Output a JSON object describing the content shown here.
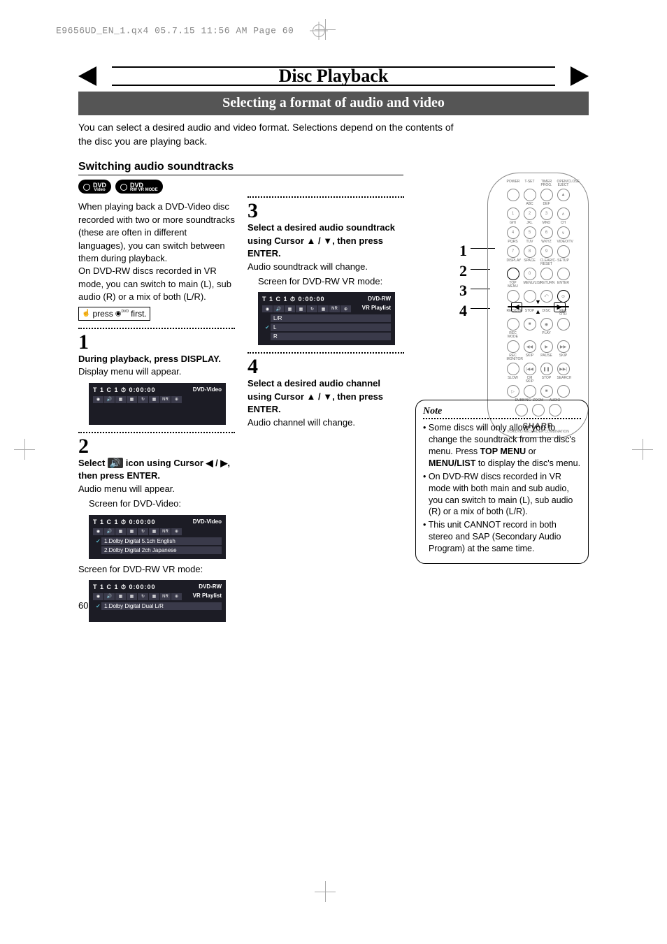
{
  "header_tag": "E9656UD_EN_1.qx4  05.7.15  11:56 AM  Page 60",
  "chapter_title": "Disc Playback",
  "section_title": "Selecting a format of audio and video",
  "intro": "You can select a desired audio and video format. Selections depend on the contents of the disc you are playing back.",
  "subhead": "Switching audio soundtracks",
  "badges": {
    "a": "DVD",
    "a_sub": "Video",
    "b": "DVD",
    "b_sub": "RW VR MODE"
  },
  "col1": {
    "p1": "When playing back a DVD-Video disc recorded with two or more soundtracks (these are often in different languages), you can switch between them during playback.",
    "p2": "On DVD-RW discs recorded in VR mode, you can switch to main (L), sub audio (R) or a mix of both (L/R).",
    "pressbox_pre": "press",
    "pressbox_post": "first.",
    "step1_instr": "During playback, press DISPLAY.",
    "step1_body": "Display menu will appear.",
    "step2_instr_a": "Select ",
    "step2_instr_b": " icon using Cursor ◀ / ▶, then press ENTER.",
    "step2_body": "Audio menu will appear.",
    "caption_dvdvideo": "Screen for DVD-Video:",
    "caption_dvdrwvr": "Screen for DVD-RW VR mode:"
  },
  "col2": {
    "step3_instr": "Select a desired audio soundtrack using Cursor ▲ / ▼, then press ENTER.",
    "step3_body": "Audio soundtrack will change.",
    "caption_dvdrwvr": "Screen for DVD-RW VR mode:",
    "step4_instr": "Select a desired audio channel using Cursor ▲ / ▼, then press ENTER.",
    "step4_body": "Audio channel will change."
  },
  "osd": {
    "title_line": "T  1  C  1  ⏱ 0:00:00",
    "dvd_video": "DVD-Video",
    "dvd_rw": "DVD-RW",
    "vr_playlist": "VR Playlist",
    "audio1": "1.Dolby Digital 5.1ch English",
    "audio2": "2.Dolby Digital 2ch Japanese",
    "audio_vr": "1.Dolby Digital Dual L/R",
    "ch_lr": "L/R",
    "ch_l": "L",
    "ch_r": "R"
  },
  "remote": {
    "brand": "SHARP",
    "sub": "VCR/DVD RECORDER COMBINATION",
    "lbl_power": "POWER",
    "lbl_tset": "T-SET",
    "lbl_timer": "TIMER PROG.",
    "lbl_open": "OPEN/CLOSE EJECT",
    "lbl_abc": "ABC",
    "lbl_def": "DEF",
    "lbl_ghi": "GHI",
    "lbl_jkl": "JKL",
    "lbl_mno": "MNO",
    "lbl_ch": "CH",
    "lbl_pqrs": "PQRS",
    "lbl_tuv": "TUV",
    "lbl_wxyz": "WXYZ",
    "lbl_video": "VIDEO/TV",
    "lbl_display": "DISPLAY",
    "lbl_space": "SPACE",
    "lbl_clear": "CLEAR/C-RESET",
    "lbl_setup": "SETUP",
    "lbl_topmenu": "TOP MENU",
    "lbl_menulist": "MENU/LIST",
    "lbl_return": "RETURN",
    "lbl_enter": "ENTER",
    "lbl_rec": "REC/OTR",
    "lbl_stop": "STOP",
    "lbl_disc": "DISC",
    "lbl_recotr": "REC OTR",
    "lbl_recmode": "REC MODE",
    "lbl_play": "PLAY",
    "lbl_recmon": "REC MONITOR",
    "lbl_skip": "SKIP",
    "lbl_pause": "PAUSE",
    "lbl_skip2": "SKIP",
    "lbl_slow": "SLOW",
    "lbl_cmskip": "CM SKIP",
    "lbl_stop2": "STOP",
    "lbl_search": "SEARCH",
    "lbl_dubbing": "DUBBING",
    "lbl_zoom": "ZOOM",
    "lbl_audio": "AUDIO"
  },
  "callouts": {
    "n1": "1",
    "n2": "2",
    "n3": "3",
    "n4": "4"
  },
  "note": {
    "title": "Note",
    "li1a": "Some discs will only allow you to change the soundtrack from the disc's menu. Press ",
    "li1b": "TOP MENU",
    "li1c": " or ",
    "li1d": "MENU/LIST",
    "li1e": " to display the disc's menu.",
    "li2": "On DVD-RW discs recorded in VR mode with both main and sub audio, you can switch to main (L), sub audio (R) or a mix of both (L/R).",
    "li3": "This unit CANNOT record in both stereo and SAP (Secondary Audio Program) at the same time."
  },
  "pagenum": "60"
}
